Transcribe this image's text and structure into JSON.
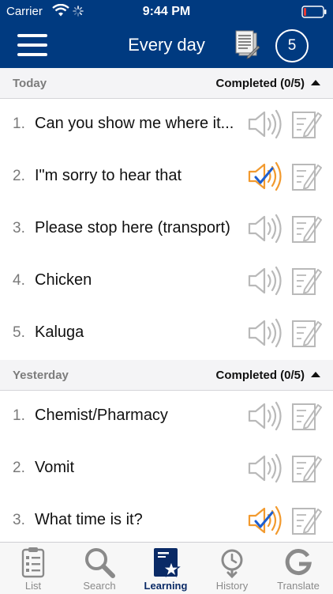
{
  "status_bar": {
    "carrier": "Carrier",
    "time": "9:44 PM"
  },
  "navbar": {
    "title": "Every day",
    "badge_count": "5",
    "icons": [
      "menu-icon",
      "document-icon"
    ]
  },
  "sections": [
    {
      "label": "Today",
      "completed": "Completed (0/5)",
      "items": [
        {
          "num": "1.",
          "text": "Can you show me where it...",
          "played": false
        },
        {
          "num": "2.",
          "text": "I\"m sorry to hear that",
          "played": true
        },
        {
          "num": "3.",
          "text": "Please stop here (transport)",
          "played": false
        },
        {
          "num": "4.",
          "text": "Chicken",
          "played": false
        },
        {
          "num": "5.",
          "text": "Kaluga",
          "played": false
        }
      ]
    },
    {
      "label": "Yesterday",
      "completed": "Completed (0/5)",
      "items": [
        {
          "num": "1.",
          "text": "Chemist/Pharmacy",
          "played": false
        },
        {
          "num": "2.",
          "text": "Vomit",
          "played": false
        },
        {
          "num": "3.",
          "text": "What time is it?",
          "played": true
        }
      ]
    }
  ],
  "tabbar": {
    "tabs": [
      {
        "label": "List",
        "icon": "clipboard-list-icon"
      },
      {
        "label": "Search",
        "icon": "magnifier-icon"
      },
      {
        "label": "Learning",
        "icon": "book-star-icon",
        "active": true
      },
      {
        "label": "History",
        "icon": "history-clock-icon"
      },
      {
        "label": "Translate",
        "icon": "google-g-icon"
      }
    ]
  },
  "colors": {
    "nav": "#003a80",
    "accent": "#f29a2e",
    "check": "#1d5fd1",
    "muted_icon": "#b9b9b9"
  }
}
